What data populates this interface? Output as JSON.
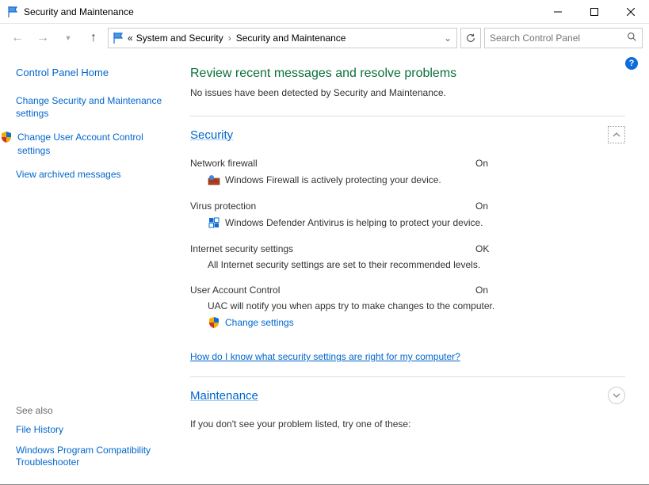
{
  "window": {
    "title": "Security and Maintenance"
  },
  "breadcrumb": {
    "prefix": "«",
    "seg1": "System and Security",
    "seg2": "Security and Maintenance"
  },
  "search": {
    "placeholder": "Search Control Panel"
  },
  "sidebar": {
    "home": "Control Panel Home",
    "links": [
      "Change Security and Maintenance settings",
      "Change User Account Control settings",
      "View archived messages"
    ],
    "see_also_head": "See also",
    "see_also": [
      "File History",
      "Windows Program Compatibility Troubleshooter"
    ]
  },
  "main": {
    "heading": "Review recent messages and resolve problems",
    "no_issues": "No issues have been detected by Security and Maintenance.",
    "security": {
      "title": "Security",
      "items": {
        "firewall": {
          "label": "Network firewall",
          "status": "On",
          "desc": "Windows Firewall is actively protecting your device."
        },
        "virus": {
          "label": "Virus protection",
          "status": "On",
          "desc": "Windows Defender Antivirus is helping to protect your device."
        },
        "internet": {
          "label": "Internet security settings",
          "status": "OK",
          "desc": "All Internet security settings are set to their recommended levels."
        },
        "uac": {
          "label": "User Account Control",
          "status": "On",
          "desc": "UAC will notify you when apps try to make changes to the computer.",
          "change": "Change settings"
        }
      },
      "help_link": "How do I know what security settings are right for my computer?"
    },
    "maintenance": {
      "title": "Maintenance"
    },
    "footer": "If you don't see your problem listed, try one of these:"
  }
}
